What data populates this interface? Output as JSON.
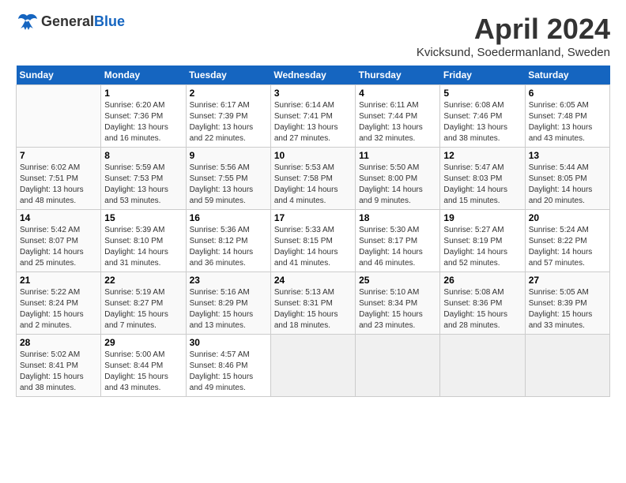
{
  "header": {
    "logo_general": "General",
    "logo_blue": "Blue",
    "month": "April 2024",
    "location": "Kvicksund, Soedermanland, Sweden"
  },
  "days_of_week": [
    "Sunday",
    "Monday",
    "Tuesday",
    "Wednesday",
    "Thursday",
    "Friday",
    "Saturday"
  ],
  "weeks": [
    [
      {
        "day": "",
        "info": ""
      },
      {
        "day": "1",
        "info": "Sunrise: 6:20 AM\nSunset: 7:36 PM\nDaylight: 13 hours\nand 16 minutes."
      },
      {
        "day": "2",
        "info": "Sunrise: 6:17 AM\nSunset: 7:39 PM\nDaylight: 13 hours\nand 22 minutes."
      },
      {
        "day": "3",
        "info": "Sunrise: 6:14 AM\nSunset: 7:41 PM\nDaylight: 13 hours\nand 27 minutes."
      },
      {
        "day": "4",
        "info": "Sunrise: 6:11 AM\nSunset: 7:44 PM\nDaylight: 13 hours\nand 32 minutes."
      },
      {
        "day": "5",
        "info": "Sunrise: 6:08 AM\nSunset: 7:46 PM\nDaylight: 13 hours\nand 38 minutes."
      },
      {
        "day": "6",
        "info": "Sunrise: 6:05 AM\nSunset: 7:48 PM\nDaylight: 13 hours\nand 43 minutes."
      }
    ],
    [
      {
        "day": "7",
        "info": "Sunrise: 6:02 AM\nSunset: 7:51 PM\nDaylight: 13 hours\nand 48 minutes."
      },
      {
        "day": "8",
        "info": "Sunrise: 5:59 AM\nSunset: 7:53 PM\nDaylight: 13 hours\nand 53 minutes."
      },
      {
        "day": "9",
        "info": "Sunrise: 5:56 AM\nSunset: 7:55 PM\nDaylight: 13 hours\nand 59 minutes."
      },
      {
        "day": "10",
        "info": "Sunrise: 5:53 AM\nSunset: 7:58 PM\nDaylight: 14 hours\nand 4 minutes."
      },
      {
        "day": "11",
        "info": "Sunrise: 5:50 AM\nSunset: 8:00 PM\nDaylight: 14 hours\nand 9 minutes."
      },
      {
        "day": "12",
        "info": "Sunrise: 5:47 AM\nSunset: 8:03 PM\nDaylight: 14 hours\nand 15 minutes."
      },
      {
        "day": "13",
        "info": "Sunrise: 5:44 AM\nSunset: 8:05 PM\nDaylight: 14 hours\nand 20 minutes."
      }
    ],
    [
      {
        "day": "14",
        "info": "Sunrise: 5:42 AM\nSunset: 8:07 PM\nDaylight: 14 hours\nand 25 minutes."
      },
      {
        "day": "15",
        "info": "Sunrise: 5:39 AM\nSunset: 8:10 PM\nDaylight: 14 hours\nand 31 minutes."
      },
      {
        "day": "16",
        "info": "Sunrise: 5:36 AM\nSunset: 8:12 PM\nDaylight: 14 hours\nand 36 minutes."
      },
      {
        "day": "17",
        "info": "Sunrise: 5:33 AM\nSunset: 8:15 PM\nDaylight: 14 hours\nand 41 minutes."
      },
      {
        "day": "18",
        "info": "Sunrise: 5:30 AM\nSunset: 8:17 PM\nDaylight: 14 hours\nand 46 minutes."
      },
      {
        "day": "19",
        "info": "Sunrise: 5:27 AM\nSunset: 8:19 PM\nDaylight: 14 hours\nand 52 minutes."
      },
      {
        "day": "20",
        "info": "Sunrise: 5:24 AM\nSunset: 8:22 PM\nDaylight: 14 hours\nand 57 minutes."
      }
    ],
    [
      {
        "day": "21",
        "info": "Sunrise: 5:22 AM\nSunset: 8:24 PM\nDaylight: 15 hours\nand 2 minutes."
      },
      {
        "day": "22",
        "info": "Sunrise: 5:19 AM\nSunset: 8:27 PM\nDaylight: 15 hours\nand 7 minutes."
      },
      {
        "day": "23",
        "info": "Sunrise: 5:16 AM\nSunset: 8:29 PM\nDaylight: 15 hours\nand 13 minutes."
      },
      {
        "day": "24",
        "info": "Sunrise: 5:13 AM\nSunset: 8:31 PM\nDaylight: 15 hours\nand 18 minutes."
      },
      {
        "day": "25",
        "info": "Sunrise: 5:10 AM\nSunset: 8:34 PM\nDaylight: 15 hours\nand 23 minutes."
      },
      {
        "day": "26",
        "info": "Sunrise: 5:08 AM\nSunset: 8:36 PM\nDaylight: 15 hours\nand 28 minutes."
      },
      {
        "day": "27",
        "info": "Sunrise: 5:05 AM\nSunset: 8:39 PM\nDaylight: 15 hours\nand 33 minutes."
      }
    ],
    [
      {
        "day": "28",
        "info": "Sunrise: 5:02 AM\nSunset: 8:41 PM\nDaylight: 15 hours\nand 38 minutes."
      },
      {
        "day": "29",
        "info": "Sunrise: 5:00 AM\nSunset: 8:44 PM\nDaylight: 15 hours\nand 43 minutes."
      },
      {
        "day": "30",
        "info": "Sunrise: 4:57 AM\nSunset: 8:46 PM\nDaylight: 15 hours\nand 49 minutes."
      },
      {
        "day": "",
        "info": ""
      },
      {
        "day": "",
        "info": ""
      },
      {
        "day": "",
        "info": ""
      },
      {
        "day": "",
        "info": ""
      }
    ]
  ]
}
